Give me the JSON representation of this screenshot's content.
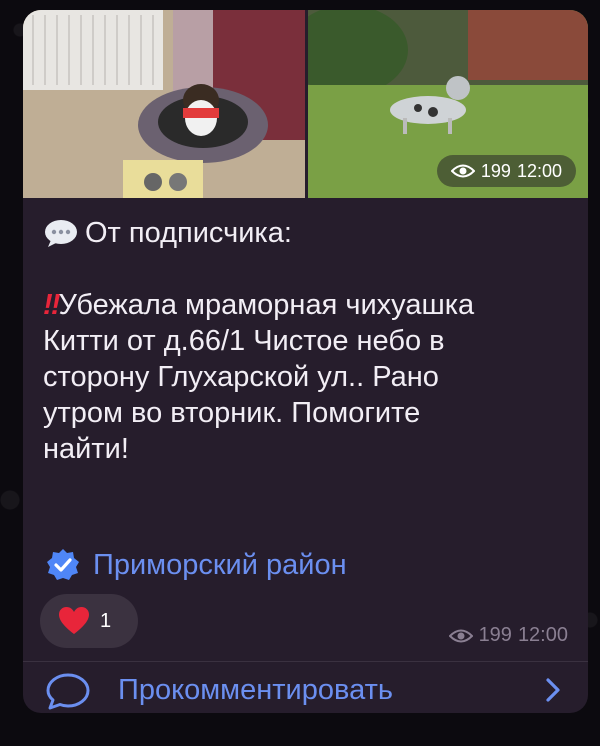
{
  "media": {
    "views": "199",
    "time": "12:00",
    "left_photo": "dog-on-pet-bed",
    "right_photo": "dog-on-grass"
  },
  "message": {
    "header_emoji": "speech-balloon-icon",
    "header_text": "От подписчика:",
    "alert_emoji": "‼",
    "body_first_line": "Убежала мраморная чихуашка",
    "body_lines": [
      "Китти от д.66/1 Чистое небо в",
      "сторону Глухарской ул.. Рано",
      "утром во вторник. Помогите",
      "найти!"
    ]
  },
  "channel": {
    "name": "Приморский район",
    "badge": "verified-badge-icon"
  },
  "reaction": {
    "emoji": "heart-icon",
    "count": "1"
  },
  "footer": {
    "views": "199",
    "time": "12:00"
  },
  "comment": {
    "label": "Прокомментировать"
  },
  "colors": {
    "bubble": "#261d2c",
    "accent": "#6b8ff0",
    "meta": "#8a7f92",
    "heart": "#e8253a"
  }
}
